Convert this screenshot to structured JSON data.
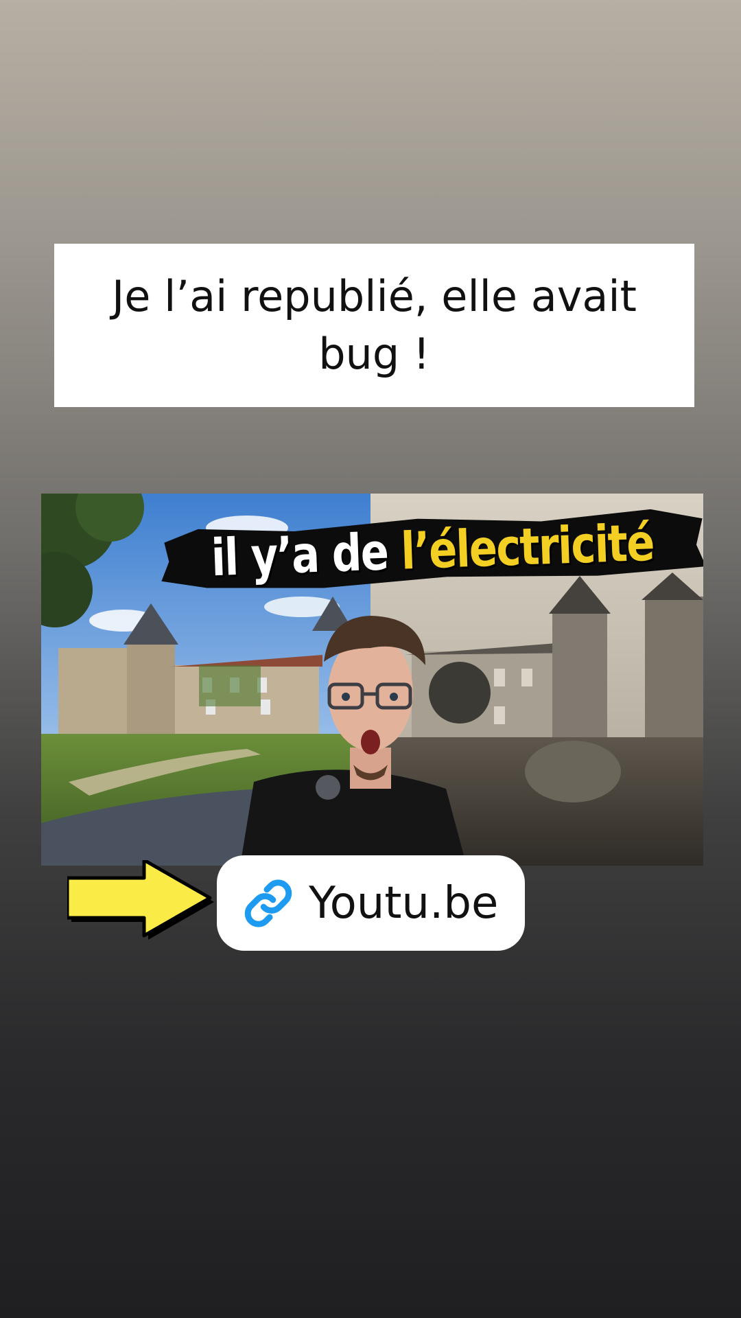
{
  "caption": {
    "text": "Je l’ai republié, elle avait bug !"
  },
  "thumbnail": {
    "title_part1": "il y’a de ",
    "title_part2": "l’électricité"
  },
  "link_sticker": {
    "label": "Youtu.be",
    "icon": "link-icon"
  },
  "colors": {
    "accent_yellow": "#f2cf22",
    "arrow_yellow": "#fbeb46",
    "link_blue": "#1d9bf0"
  }
}
